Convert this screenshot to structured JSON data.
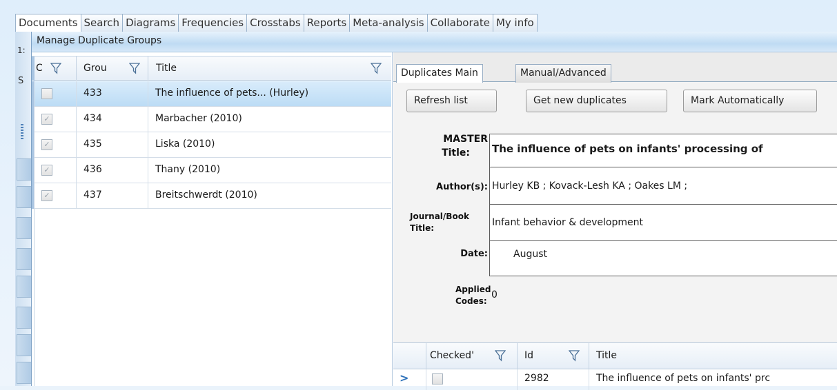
{
  "main_tabs": [
    {
      "label": "Documents"
    },
    {
      "label": "Search"
    },
    {
      "label": "Diagrams"
    },
    {
      "label": "Frequencies"
    },
    {
      "label": "Crosstabs"
    },
    {
      "label": "Reports"
    },
    {
      "label": "Meta-analysis"
    },
    {
      "label": "Collaborate"
    },
    {
      "label": "My info"
    }
  ],
  "background": {
    "left_label": "1:",
    "s_label": "S"
  },
  "dialog": {
    "title": "Manage Duplicate Groups",
    "groups_grid": {
      "columns": {
        "checked": "C",
        "group": "Grou",
        "title": "Title"
      },
      "rows": [
        {
          "checked": false,
          "group": "433",
          "title": "The influence of pets... (Hurley)",
          "selected": true
        },
        {
          "checked": true,
          "group": "434",
          "title": "Marbacher (2010)",
          "selected": false
        },
        {
          "checked": true,
          "group": "435",
          "title": "Liska (2010)",
          "selected": false
        },
        {
          "checked": true,
          "group": "436",
          "title": "Thany (2010)",
          "selected": false
        },
        {
          "checked": true,
          "group": "437",
          "title": "Breitschwerdt (2010)",
          "selected": false
        }
      ]
    },
    "tabs": {
      "main": "Duplicates Main",
      "manual": "Manual/Advanced"
    },
    "buttons": {
      "refresh": "Refresh list",
      "get_new": "Get new duplicates",
      "mark_auto": "Mark Automatically"
    },
    "master": {
      "title_label_1": "MASTER",
      "title_label_2": "Title:",
      "title_value": "The influence of pets on infants' processing of",
      "authors_label": "Author(s):",
      "authors_value": "Hurley KB ; Kovack-Lesh KA ; Oakes LM ;",
      "journal_label_1": "Journal/Book",
      "journal_label_2": "Title:",
      "journal_value": "Infant behavior & development",
      "date_label": "Date:",
      "date_value": "August",
      "codes_label_1": "Applied",
      "codes_label_2": "Codes:",
      "codes_value": "0"
    },
    "dup_grid": {
      "columns": {
        "checked": "Checked'",
        "id": "Id",
        "title": "Title"
      },
      "rows": [
        {
          "indicator": ">",
          "checked": false,
          "id": "2982",
          "title": "The influence of pets on infants' prc"
        }
      ]
    }
  }
}
